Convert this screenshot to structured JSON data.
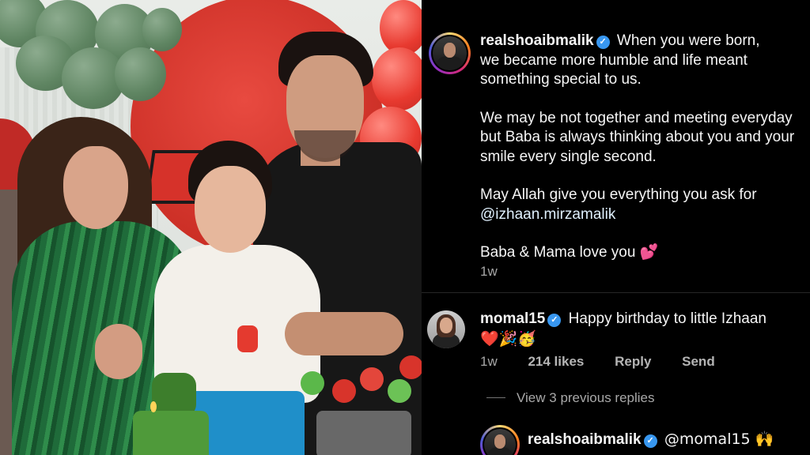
{
  "post": {
    "username": "realshoaibmalik",
    "caption_lines": [
      "When you were born,",
      "we became more humble and life meant",
      "something special to us."
    ],
    "caption_para2": [
      "We may be not together and meeting everyday",
      "but Baba is always thinking about you and your",
      "smile every single second."
    ],
    "caption_para3": [
      "May Allah give you everything you ask for",
      "@izhaan.mirzamalik"
    ],
    "caption_para4": "Baba & Mama love you 💕",
    "time": "1w"
  },
  "comment": {
    "username": "momal15",
    "text": "Happy birthday to little Izhaan",
    "emojis": "❤️🎉🥳",
    "time": "1w",
    "likes": "214 likes",
    "reply_label": "Reply",
    "send_label": "Send"
  },
  "view_replies_label": "View 3 previous replies",
  "reply": {
    "username": "realshoaibmalik",
    "text": "@momal15 🙌"
  },
  "colors": {
    "background": "#000000",
    "text": "#f5f5f5",
    "secondary_text": "#a8a8a8",
    "verified": "#3897f0"
  }
}
